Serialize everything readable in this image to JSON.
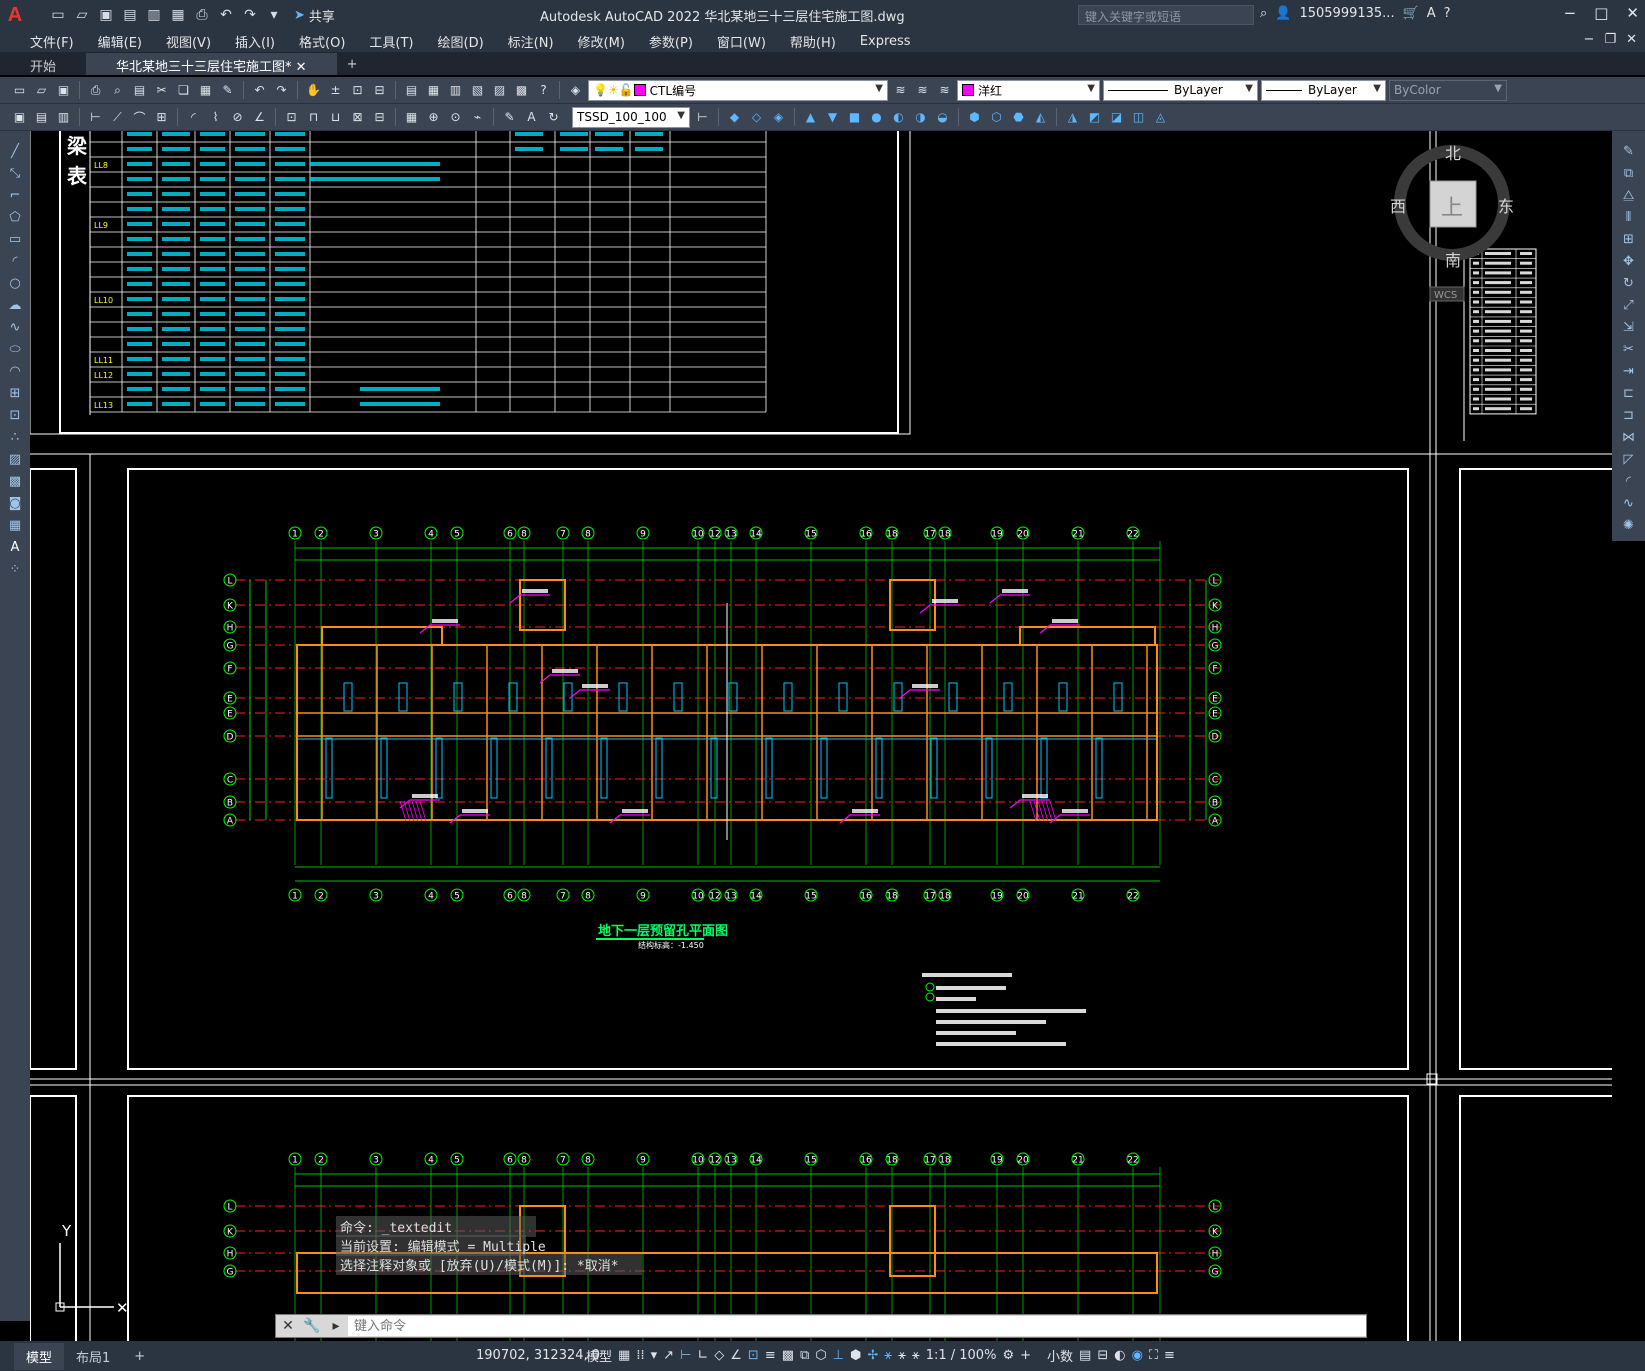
{
  "app": {
    "logo": "A",
    "title": "Autodesk AutoCAD 2022    华北某地三十三层住宅施工图.dwg",
    "share_label": "共享",
    "search_placeholder": "键入关键字或短语",
    "user": "1505999135...",
    "window_controls": [
      "−",
      "□",
      "✕"
    ]
  },
  "menu": {
    "items": [
      "文件(F)",
      "编辑(E)",
      "视图(V)",
      "插入(I)",
      "格式(O)",
      "工具(T)",
      "绘图(D)",
      "标注(N)",
      "修改(M)",
      "参数(P)",
      "窗口(W)",
      "帮助(H)",
      "Express"
    ]
  },
  "tabs": {
    "start": "开始",
    "doc": "华北某地三十三层住宅施工图*",
    "plus": "+"
  },
  "toolbar1": {
    "layer": "CTL编号",
    "color": "洋红",
    "linetype": "ByLayer",
    "lineweight": "ByLayer",
    "plotstyle": "ByColor"
  },
  "toolbar2": {
    "dimstyle": "TSSD_100_100"
  },
  "drawing": {
    "table_title_chars": [
      "梁",
      "表"
    ],
    "beam_ids": [
      "LL8",
      "LL9",
      "LL10",
      "LL11",
      "LL12",
      "LL13"
    ],
    "plan_title": "地下一层预留孔平面图",
    "plan_elev": "结构标高：-1.450",
    "compass": {
      "north": "北",
      "south": "南",
      "east": "东",
      "west": "西",
      "top": "上",
      "wcs": "WCS"
    },
    "grid_top": [
      "1",
      "2",
      "3",
      "4",
      "5",
      "6",
      "8",
      "7",
      "8",
      "9",
      "10",
      "12",
      "13",
      "14",
      "15",
      "16",
      "18",
      "17",
      "18",
      "19",
      "20",
      "21",
      "22"
    ],
    "grid_side": [
      "L",
      "K",
      "H",
      "G",
      "F",
      "E",
      "E",
      "D",
      "C",
      "B",
      "A"
    ],
    "ucs_y": "Y"
  },
  "command": {
    "history": [
      "命令: _textedit",
      "当前设置: 编辑模式 = Multiple",
      "选择注释对象或 [放弃(U)/模式(M)]: *取消*"
    ],
    "placeholder": "键入命令"
  },
  "status": {
    "model_tab": "模型",
    "layout_tab": "布局1",
    "coords": "190702, 312324, 0",
    "model_label": "模型",
    "scale": "1:1 / 100%",
    "units": "小数"
  }
}
